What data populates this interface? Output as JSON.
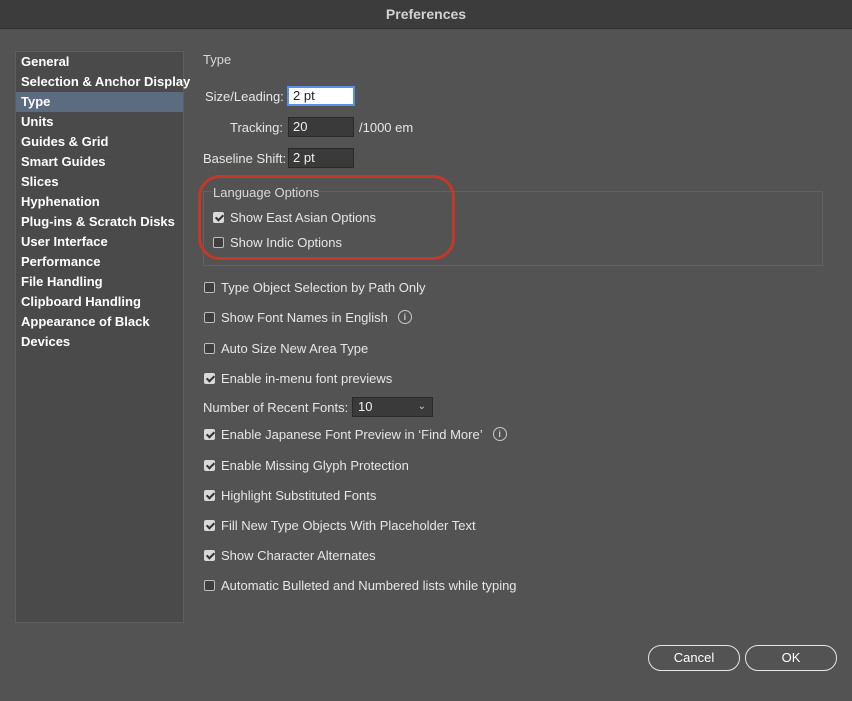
{
  "window": {
    "title": "Preferences"
  },
  "sidebar": {
    "items": [
      {
        "label": "General"
      },
      {
        "label": "Selection & Anchor Display"
      },
      {
        "label": "Type",
        "active": true
      },
      {
        "label": "Units"
      },
      {
        "label": "Guides & Grid"
      },
      {
        "label": "Smart Guides"
      },
      {
        "label": "Slices"
      },
      {
        "label": "Hyphenation"
      },
      {
        "label": "Plug-ins & Scratch Disks"
      },
      {
        "label": "User Interface"
      },
      {
        "label": "Performance"
      },
      {
        "label": "File Handling"
      },
      {
        "label": "Clipboard Handling"
      },
      {
        "label": "Appearance of Black"
      },
      {
        "label": "Devices"
      }
    ]
  },
  "type_panel": {
    "section_title": "Type",
    "size_leading": {
      "label": "Size/Leading:",
      "value": "2 pt"
    },
    "tracking": {
      "label": "Tracking:",
      "value": "20",
      "unit": "/1000 em"
    },
    "baseline_shift": {
      "label": "Baseline Shift:",
      "value": "2 pt"
    },
    "language_options": {
      "title": "Language Options",
      "show_east_asian": {
        "label": "Show East Asian Options",
        "checked": true
      },
      "show_indic": {
        "label": "Show Indic Options",
        "checked": false
      }
    },
    "options": {
      "type_object_selection": {
        "label": "Type Object Selection by Path Only",
        "checked": false
      },
      "font_names_english": {
        "label": "Show Font Names in English",
        "checked": false
      },
      "auto_size_area": {
        "label": "Auto Size New Area Type",
        "checked": false
      },
      "in_menu_previews": {
        "label": "Enable in-menu font previews",
        "checked": true
      },
      "recent_fonts": {
        "label": "Number of Recent Fonts:",
        "value": "10"
      },
      "japanese_preview": {
        "label": "Enable Japanese Font Preview in ‘Find More’",
        "checked": true
      },
      "missing_glyph": {
        "label": "Enable Missing Glyph Protection",
        "checked": true
      },
      "highlight_substituted": {
        "label": "Highlight Substituted Fonts",
        "checked": true
      },
      "fill_placeholder": {
        "label": "Fill New Type Objects With Placeholder Text",
        "checked": true
      },
      "character_alternates": {
        "label": "Show Character Alternates",
        "checked": true
      },
      "auto_bullets": {
        "label": "Automatic Bulleted and Numbered lists while typing",
        "checked": false
      }
    }
  },
  "buttons": {
    "cancel": "Cancel",
    "ok": "OK"
  },
  "icons": {
    "info": "info-icon",
    "dropdown": "chevron-down-icon",
    "checkbox": "checkbox-icon"
  },
  "colors": {
    "highlight_ring": "#c0392b",
    "active_item": "#5b6b80",
    "focus_border": "#5a8ee8"
  }
}
